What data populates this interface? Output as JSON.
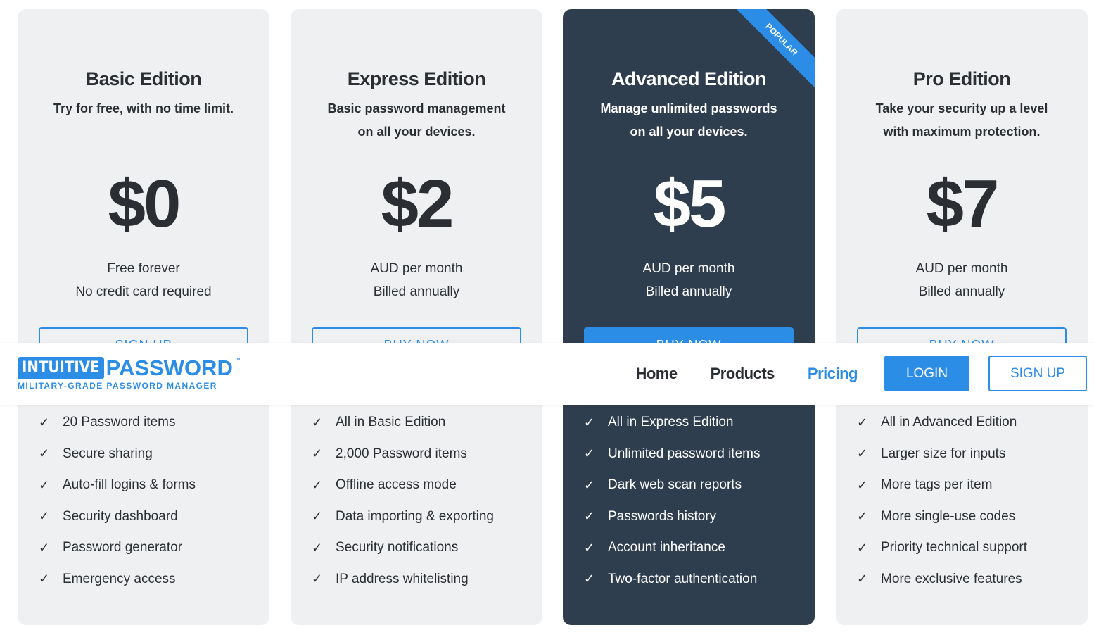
{
  "header": {
    "logo": {
      "word1": "INTUITIVE",
      "word2": "PASSWORD",
      "tm": "™",
      "tagline": "MILITARY-GRADE PASSWORD MANAGER"
    },
    "nav": [
      {
        "label": "Home"
      },
      {
        "label": "Products"
      },
      {
        "label": "Pricing",
        "active": true
      }
    ],
    "login": "LOGIN",
    "signup": "SIGN UP"
  },
  "accent": "#2b8de6",
  "plans": [
    {
      "title": "Basic Edition",
      "desc": "Try for free, with no time limit.",
      "price": "$0",
      "note1": "Free forever",
      "note2": "No credit card required",
      "button": "SIGN UP",
      "features": [
        "20 Password items",
        "Secure sharing",
        "Auto-fill logins & forms",
        "Security dashboard",
        "Password generator",
        "Emergency access"
      ]
    },
    {
      "title": "Express Edition",
      "desc": "Basic password management on all your devices.",
      "price": "$2",
      "note1": "AUD per month",
      "note2": "Billed annually",
      "button": "BUY NOW",
      "features": [
        "All in Basic Edition",
        "2,000 Password items",
        "Offline access mode",
        "Data importing & exporting",
        "Security notifications",
        "IP address whitelisting"
      ]
    },
    {
      "title": "Advanced Edition",
      "desc": "Manage unlimited passwords on all your devices.",
      "price": "$5",
      "note1": "AUD per month",
      "note2": "Billed annually",
      "button": "BUY NOW",
      "badge": "POPULAR",
      "features": [
        "All in Express Edition",
        "Unlimited password items",
        "Dark web scan reports",
        "Passwords history",
        "Account inheritance",
        "Two-factor authentication"
      ]
    },
    {
      "title": "Pro Edition",
      "desc": "Take your security up a level with maximum protection.",
      "price": "$7",
      "note1": "AUD per month",
      "note2": "Billed annually",
      "button": "BUY NOW",
      "features": [
        "All in Advanced Edition",
        "Larger size for inputs",
        "More tags per item",
        "More single-use codes",
        "Priority technical support",
        "More exclusive features"
      ]
    }
  ]
}
